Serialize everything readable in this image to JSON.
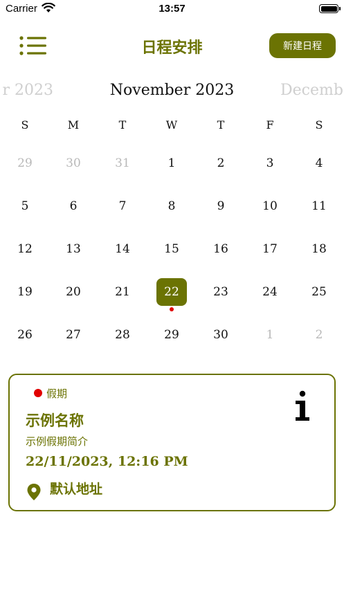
{
  "status_bar": {
    "carrier": "Carrier",
    "time": "13:57"
  },
  "nav": {
    "title": "日程安排",
    "new_button": "新建日程",
    "menu_icon": "list-icon"
  },
  "calendar": {
    "prev_month": "r 2023",
    "current_month": "November 2023",
    "next_month": "Decemb",
    "weekdays": [
      "S",
      "M",
      "T",
      "W",
      "T",
      "F",
      "S"
    ],
    "weeks": [
      [
        "29",
        "30",
        "31",
        "1",
        "2",
        "3",
        "4"
      ],
      [
        "5",
        "6",
        "7",
        "8",
        "9",
        "10",
        "11"
      ],
      [
        "12",
        "13",
        "14",
        "15",
        "16",
        "17",
        "18"
      ],
      [
        "19",
        "20",
        "21",
        "22",
        "23",
        "24",
        "25"
      ],
      [
        "26",
        "27",
        "28",
        "29",
        "30",
        "1",
        "2"
      ]
    ],
    "selected_day": "22",
    "event_dot_color": "#e10000"
  },
  "event_card": {
    "category": "假期",
    "category_color": "#e10000",
    "title": "示例名称",
    "description": "示例假期简介",
    "datetime": "22/11/2023, 12:16 PM",
    "address": "默认地址",
    "info_icon": "info-icon",
    "address_icon": "location-pin-icon"
  },
  "colors": {
    "accent": "#6b7303",
    "muted_text": "#b9b9b9"
  }
}
